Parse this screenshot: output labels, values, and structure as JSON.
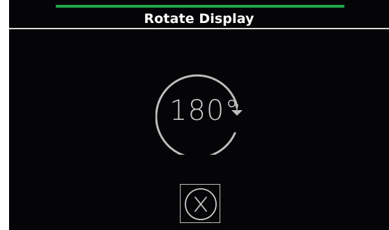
{
  "header": {
    "title": "Rotate Display",
    "progress": 1.0,
    "progress_color": "#21a84a"
  },
  "dial": {
    "rotation_label": "180°",
    "icon": "rotate-clockwise-icon"
  },
  "actions": {
    "cancel_icon": "close-circle-icon"
  },
  "colors": {
    "background": "#050507",
    "foreground": "#ffffff",
    "dial_stroke": "#bdbdbd"
  }
}
